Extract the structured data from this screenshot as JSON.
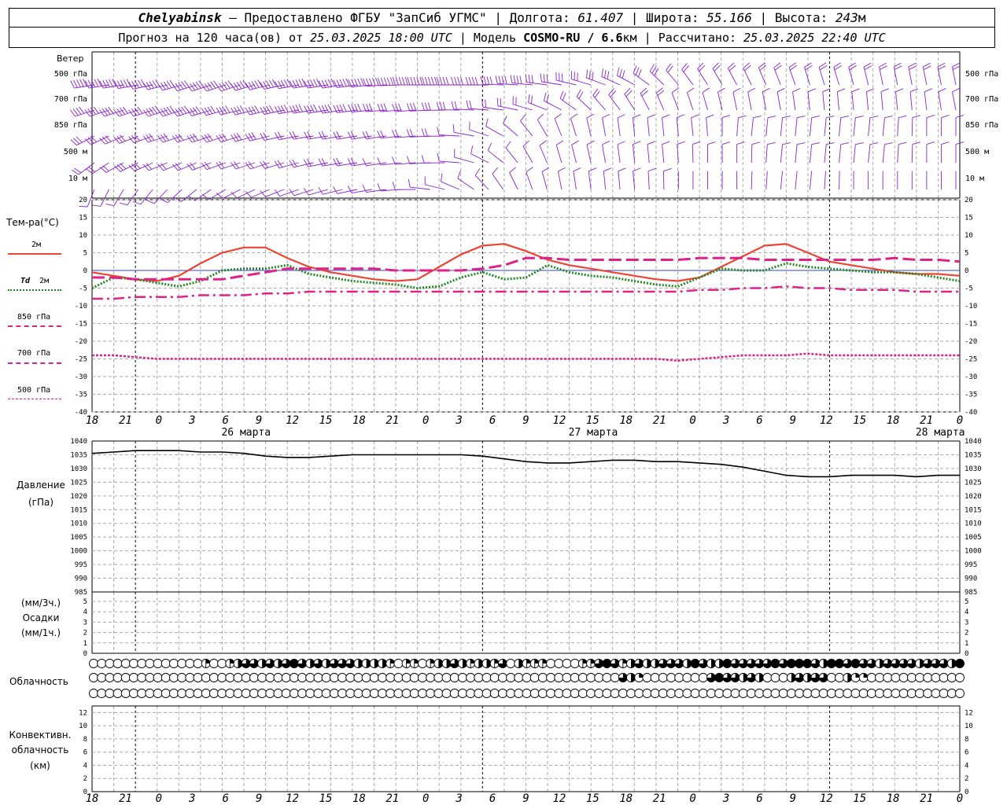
{
  "header": {
    "station": "Chelyabinsk",
    "dash": "–",
    "provider": "Предоставлено ФГБУ \"ЗапСиб УГМС\"",
    "sep": "|",
    "lon_label": "Долгота:",
    "lon": "61.407",
    "lat_label": "Широта:",
    "lat": "55.166",
    "alt_label": "Высота:",
    "alt": "243",
    "alt_unit": "м"
  },
  "subheader": {
    "forecast_prefix": "Прогноз на 120 часа(ов) от",
    "forecast_time": "25.03.2025 18:00 UTC",
    "model_prefix": "Модель",
    "model": "COSMO-RU / 6.6",
    "model_unit": "км",
    "calc_prefix": "Рассчитано:",
    "calc_time": "25.03.2025 22:40 UTC"
  },
  "wind_panel": {
    "title": "Ветер",
    "levels": [
      "500 гПа",
      "700 гПа",
      "850 гПа",
      "500 м",
      "10 м"
    ]
  },
  "temp_panel": {
    "title": "Тем-ра(°C)",
    "legend": [
      {
        "label": "2м",
        "color": "#ee4433",
        "style": "solid"
      },
      {
        "label_a": "Td",
        "label_b": "2м",
        "color": "#228822",
        "style": "dotted"
      },
      {
        "label": "850 гПа",
        "color": "#dd2288",
        "style": "dashdot"
      },
      {
        "label": "700 гПа",
        "color": "#dd2288",
        "style": "dashed"
      },
      {
        "label": "500 гПа",
        "color": "#dd2288",
        "style": "finedash"
      }
    ],
    "y_ticks": [
      "20",
      "15",
      "10",
      "5",
      "0",
      "-5",
      "-10",
      "-15",
      "-20",
      "-25",
      "-30",
      "-35",
      "-40"
    ]
  },
  "time_axis": {
    "labels": [
      "18",
      "21",
      "0",
      "3",
      "6",
      "9",
      "12",
      "15",
      "18",
      "21",
      "0",
      "3",
      "6",
      "9",
      "12",
      "15",
      "18",
      "21",
      "0",
      "3",
      "6",
      "9",
      "12",
      "15",
      "18",
      "21",
      "0"
    ],
    "days": [
      "26 марта",
      "27 марта",
      "28 марта"
    ]
  },
  "pressure_panel": {
    "title_a": "Давление",
    "title_b": "(гПа)",
    "y_ticks": [
      "1040",
      "1035",
      "1030",
      "1025",
      "1020",
      "1015",
      "1010",
      "1005",
      "1000",
      "995",
      "990",
      "985"
    ]
  },
  "precip_panel": {
    "title_a": "(мм/3ч.)",
    "title_b": "Осадки",
    "title_c": "(мм/1ч.)",
    "y_ticks": [
      "5",
      "4",
      "3",
      "2",
      "1",
      "0"
    ]
  },
  "cloud_panel": {
    "title": "Облачность"
  },
  "conv_panel": {
    "title_a": "Конвективн.",
    "title_b": "облачность",
    "title_c": "(км)",
    "y_ticks": [
      "12",
      "10",
      "8",
      "6",
      "4",
      "2",
      "0"
    ]
  },
  "chart_data": [
    {
      "type": "line",
      "title": "Тем-ра(°C)",
      "x_hours": [
        0,
        3,
        6,
        9,
        12,
        15,
        18,
        21,
        24,
        27,
        30,
        33,
        36,
        39,
        42,
        45,
        48,
        51,
        54,
        57,
        60,
        63,
        66,
        69,
        72,
        75,
        78,
        81,
        84,
        87,
        90,
        93,
        96,
        99,
        102,
        105,
        108,
        111,
        114,
        117,
        120
      ],
      "ylim": [
        -40,
        20
      ],
      "series": [
        {
          "name": "2м",
          "values": [
            -0.5,
            -1.5,
            -2.5,
            -3,
            -1.5,
            2,
            5,
            6.5,
            6.5,
            3.5,
            1,
            -0.5,
            -1.5,
            -2.5,
            -3,
            -2.5,
            1,
            4.5,
            7,
            7.5,
            5.5,
            3,
            1.5,
            0.5,
            -0.5,
            -1.5,
            -2.5,
            -3,
            -2,
            1,
            4,
            7,
            7.5,
            5,
            2.5,
            1.5,
            0.5,
            -0.5,
            -1,
            -1,
            -1.5
          ]
        },
        {
          "name": "Td 2м",
          "values": [
            -5,
            -2,
            -2.5,
            -3.5,
            -4.5,
            -3,
            0,
            0.5,
            0.5,
            1.5,
            -1,
            -2,
            -3,
            -3.5,
            -4,
            -5,
            -4.5,
            -2,
            -0.5,
            -2.5,
            -2,
            1.5,
            -0.5,
            -1.5,
            -2,
            -3,
            -4,
            -4.5,
            -2,
            0.5,
            0,
            0,
            2,
            1,
            0.5,
            0,
            -0.5,
            -0.5,
            -1,
            -2,
            -3
          ]
        },
        {
          "name": "850 гПа",
          "values": [
            -8,
            -8,
            -7.5,
            -7.5,
            -7.5,
            -7,
            -7,
            -7,
            -6.5,
            -6.5,
            -6,
            -6,
            -6,
            -6,
            -6,
            -6,
            -6,
            -6,
            -6,
            -6,
            -6,
            -6,
            -6,
            -6,
            -6,
            -6,
            -6,
            -6,
            -5.5,
            -5.5,
            -5,
            -5,
            -4.5,
            -5,
            -5,
            -5.5,
            -5.5,
            -5.5,
            -6,
            -6,
            -6
          ]
        },
        {
          "name": "700 гПа",
          "values": [
            -2,
            -2,
            -2.5,
            -2.5,
            -2.5,
            -2.5,
            -2.5,
            -1.5,
            -0.5,
            0.5,
            0.5,
            0.5,
            0.5,
            0.5,
            0,
            0,
            0,
            0,
            0.5,
            1.5,
            3.5,
            3.5,
            3,
            3,
            3,
            3,
            3,
            3,
            3.5,
            3.5,
            3.5,
            3,
            3,
            3,
            3,
            3,
            3,
            3.5,
            3,
            3,
            2.5
          ]
        },
        {
          "name": "500 гПа",
          "values": [
            -24,
            -24,
            -24.5,
            -25,
            -25,
            -25,
            -25,
            -25,
            -25,
            -25,
            -25,
            -25,
            -25,
            -25,
            -25,
            -25,
            -25,
            -25,
            -25,
            -25,
            -25,
            -25,
            -25,
            -25,
            -25,
            -25,
            -25,
            -25.5,
            -25,
            -24.5,
            -24,
            -24,
            -24,
            -23.5,
            -24,
            -24,
            -24,
            -24,
            -24,
            -24,
            -24
          ]
        }
      ]
    },
    {
      "type": "line",
      "title": "Давление (гПа)",
      "x_hours": [
        0,
        3,
        6,
        9,
        12,
        15,
        18,
        21,
        24,
        27,
        30,
        33,
        36,
        39,
        42,
        45,
        48,
        51,
        54,
        57,
        60,
        63,
        66,
        69,
        72,
        75,
        78,
        81,
        84,
        87,
        90,
        93,
        96,
        99,
        102,
        105,
        108,
        111,
        114,
        117,
        120
      ],
      "ylim": [
        985,
        1040
      ],
      "series": [
        {
          "name": "p",
          "values": [
            1035.5,
            1036,
            1036.5,
            1036.5,
            1036.5,
            1036,
            1036,
            1035.5,
            1034.5,
            1034,
            1034,
            1034.5,
            1035,
            1035,
            1035,
            1035,
            1035,
            1035,
            1034.5,
            1033.5,
            1032.5,
            1032,
            1032,
            1032.5,
            1033,
            1033,
            1032.5,
            1032.5,
            1032,
            1031.5,
            1030.5,
            1029,
            1027.5,
            1027,
            1027,
            1027.5,
            1027.5,
            1027.5,
            1027,
            1027.5,
            1027.5
          ]
        }
      ]
    },
    {
      "type": "bar",
      "title": "Осадки (мм/3ч.)",
      "ylim": [
        0,
        5
      ],
      "values": []
    },
    {
      "type": "table",
      "title": "Облачность",
      "rows": {
        "upper": [
          0,
          0,
          0,
          0,
          0,
          0,
          0,
          0,
          0,
          0,
          0,
          0,
          0,
          0,
          1,
          0,
          0,
          1,
          2,
          3,
          3,
          2,
          3,
          2,
          3,
          4,
          3,
          2,
          3,
          2,
          3,
          3,
          3,
          2,
          2,
          2,
          2,
          1,
          0,
          1,
          1,
          0,
          1,
          2,
          2,
          3,
          2,
          1,
          2,
          2,
          1,
          3,
          0,
          2,
          1,
          1,
          1,
          0,
          0,
          0,
          0,
          1,
          1,
          3,
          4,
          3,
          1,
          2,
          3,
          2,
          2,
          3,
          3,
          3,
          2,
          4,
          3,
          2,
          2,
          4,
          3,
          3,
          3,
          3,
          3,
          4,
          3,
          4,
          4,
          4,
          3,
          2,
          4,
          4,
          3,
          4,
          3,
          3,
          2,
          3,
          3,
          3,
          3,
          2,
          3,
          3,
          3,
          2,
          4
        ],
        "middle": [
          0,
          0,
          0,
          0,
          0,
          0,
          0,
          0,
          0,
          0,
          0,
          0,
          0,
          0,
          0,
          0,
          0,
          0,
          0,
          0,
          0,
          0,
          0,
          0,
          0,
          0,
          0,
          0,
          0,
          0,
          0,
          0,
          0,
          0,
          0,
          0,
          0,
          0,
          0,
          0,
          0,
          0,
          0,
          0,
          0,
          0,
          0,
          0,
          0,
          0,
          0,
          0,
          0,
          0,
          0,
          0,
          0,
          0,
          0,
          0,
          0,
          0,
          0,
          0,
          0,
          0,
          3,
          2,
          1,
          0,
          0,
          0,
          0,
          0,
          0,
          0,
          0,
          3,
          4,
          3,
          3,
          2,
          3,
          2,
          0,
          0,
          0,
          2,
          3,
          2,
          3,
          3,
          0,
          0,
          2,
          1,
          1,
          0,
          0,
          0,
          0,
          0,
          0,
          0,
          0,
          0,
          0,
          0,
          0
        ],
        "lower": [
          0,
          0,
          0,
          0,
          0,
          0,
          0,
          0,
          0,
          0,
          0,
          0,
          0,
          0,
          0,
          0,
          0,
          0,
          0,
          0,
          0,
          0,
          0,
          0,
          0,
          0,
          0,
          0,
          0,
          0,
          0,
          0,
          0,
          0,
          0,
          0,
          0,
          0,
          0,
          0,
          0,
          0,
          0,
          0,
          0,
          0,
          0,
          0,
          0,
          0,
          0,
          0,
          0,
          0,
          0,
          0,
          0,
          0,
          0,
          0,
          0,
          0,
          0,
          0,
          0,
          0,
          0,
          0,
          0,
          0,
          0,
          0,
          0,
          0,
          0,
          0,
          0,
          0,
          0,
          0,
          0,
          0,
          0,
          0,
          0,
          0,
          0,
          0,
          0,
          0,
          0,
          0,
          0,
          0,
          0,
          0,
          0,
          0,
          0,
          0,
          0,
          0,
          0,
          0,
          0,
          0,
          0,
          0,
          0
        ]
      }
    },
    {
      "type": "bar",
      "title": "Конвективн. облачность (км)",
      "ylim": [
        0,
        13
      ],
      "values": []
    },
    {
      "type": "scatter",
      "title": "Ветер",
      "levels": [
        "500 гПа",
        "700 гПа",
        "850 гПа",
        "500 м",
        "10 м"
      ],
      "direction_deg": {
        "500 гПа": [
          260,
          260,
          255,
          250,
          250,
          255,
          260,
          260,
          265,
          270,
          270,
          270,
          275,
          280,
          290,
          300,
          320,
          330,
          335,
          340,
          345,
          345,
          350,
          350,
          350
        ],
        "700 гПа": [
          250,
          250,
          250,
          250,
          255,
          255,
          260,
          260,
          265,
          265,
          270,
          275,
          285,
          300,
          320,
          330,
          340,
          345,
          350,
          350,
          355,
          355,
          355,
          355,
          350
        ],
        "850 гПа": [
          240,
          245,
          250,
          250,
          250,
          255,
          260,
          260,
          260,
          265,
          270,
          290,
          320,
          340,
          350,
          355,
          355,
          355,
          5,
          5,
          5,
          5,
          5,
          0,
          0
        ],
        "500 м": [
          230,
          240,
          245,
          245,
          250,
          250,
          255,
          260,
          260,
          265,
          270,
          300,
          330,
          345,
          350,
          355,
          355,
          0,
          0,
          5,
          5,
          5,
          5,
          0,
          0
        ],
        "10 м": [
          200,
          210,
          220,
          230,
          240,
          245,
          250,
          255,
          260,
          270,
          290,
          320,
          340,
          350,
          355,
          355,
          0,
          0,
          0,
          5,
          5,
          0,
          0,
          0,
          0
        ]
      },
      "speed_ms": {
        "500 гПа": [
          30,
          31,
          32,
          33,
          33,
          32,
          31,
          30,
          28,
          26,
          24,
          22,
          20,
          18,
          16,
          15,
          14,
          13,
          13,
          12,
          12,
          12,
          11,
          11,
          11
        ],
        "700 гПа": [
          22,
          23,
          24,
          24,
          23,
          22,
          21,
          20,
          19,
          17,
          15,
          13,
          11,
          10,
          9,
          9,
          9,
          8,
          8,
          8,
          8,
          8,
          8,
          8,
          8
        ],
        "850 гПа": [
          15,
          16,
          16,
          16,
          15,
          14,
          13,
          12,
          11,
          10,
          9,
          8,
          7,
          7,
          7,
          7,
          7,
          6,
          6,
          6,
          6,
          6,
          6,
          6,
          6
        ],
        "500 м": [
          13,
          14,
          14,
          13,
          13,
          12,
          11,
          10,
          9,
          8,
          7,
          7,
          6,
          6,
          6,
          6,
          6,
          5,
          5,
          5,
          5,
          5,
          5,
          5,
          5
        ],
        "10 м": [
          5,
          5,
          5,
          5,
          5,
          5,
          5,
          4,
          4,
          4,
          4,
          4,
          4,
          4,
          4,
          4,
          4,
          3,
          3,
          3,
          3,
          3,
          3,
          3,
          3
        ]
      }
    }
  ]
}
